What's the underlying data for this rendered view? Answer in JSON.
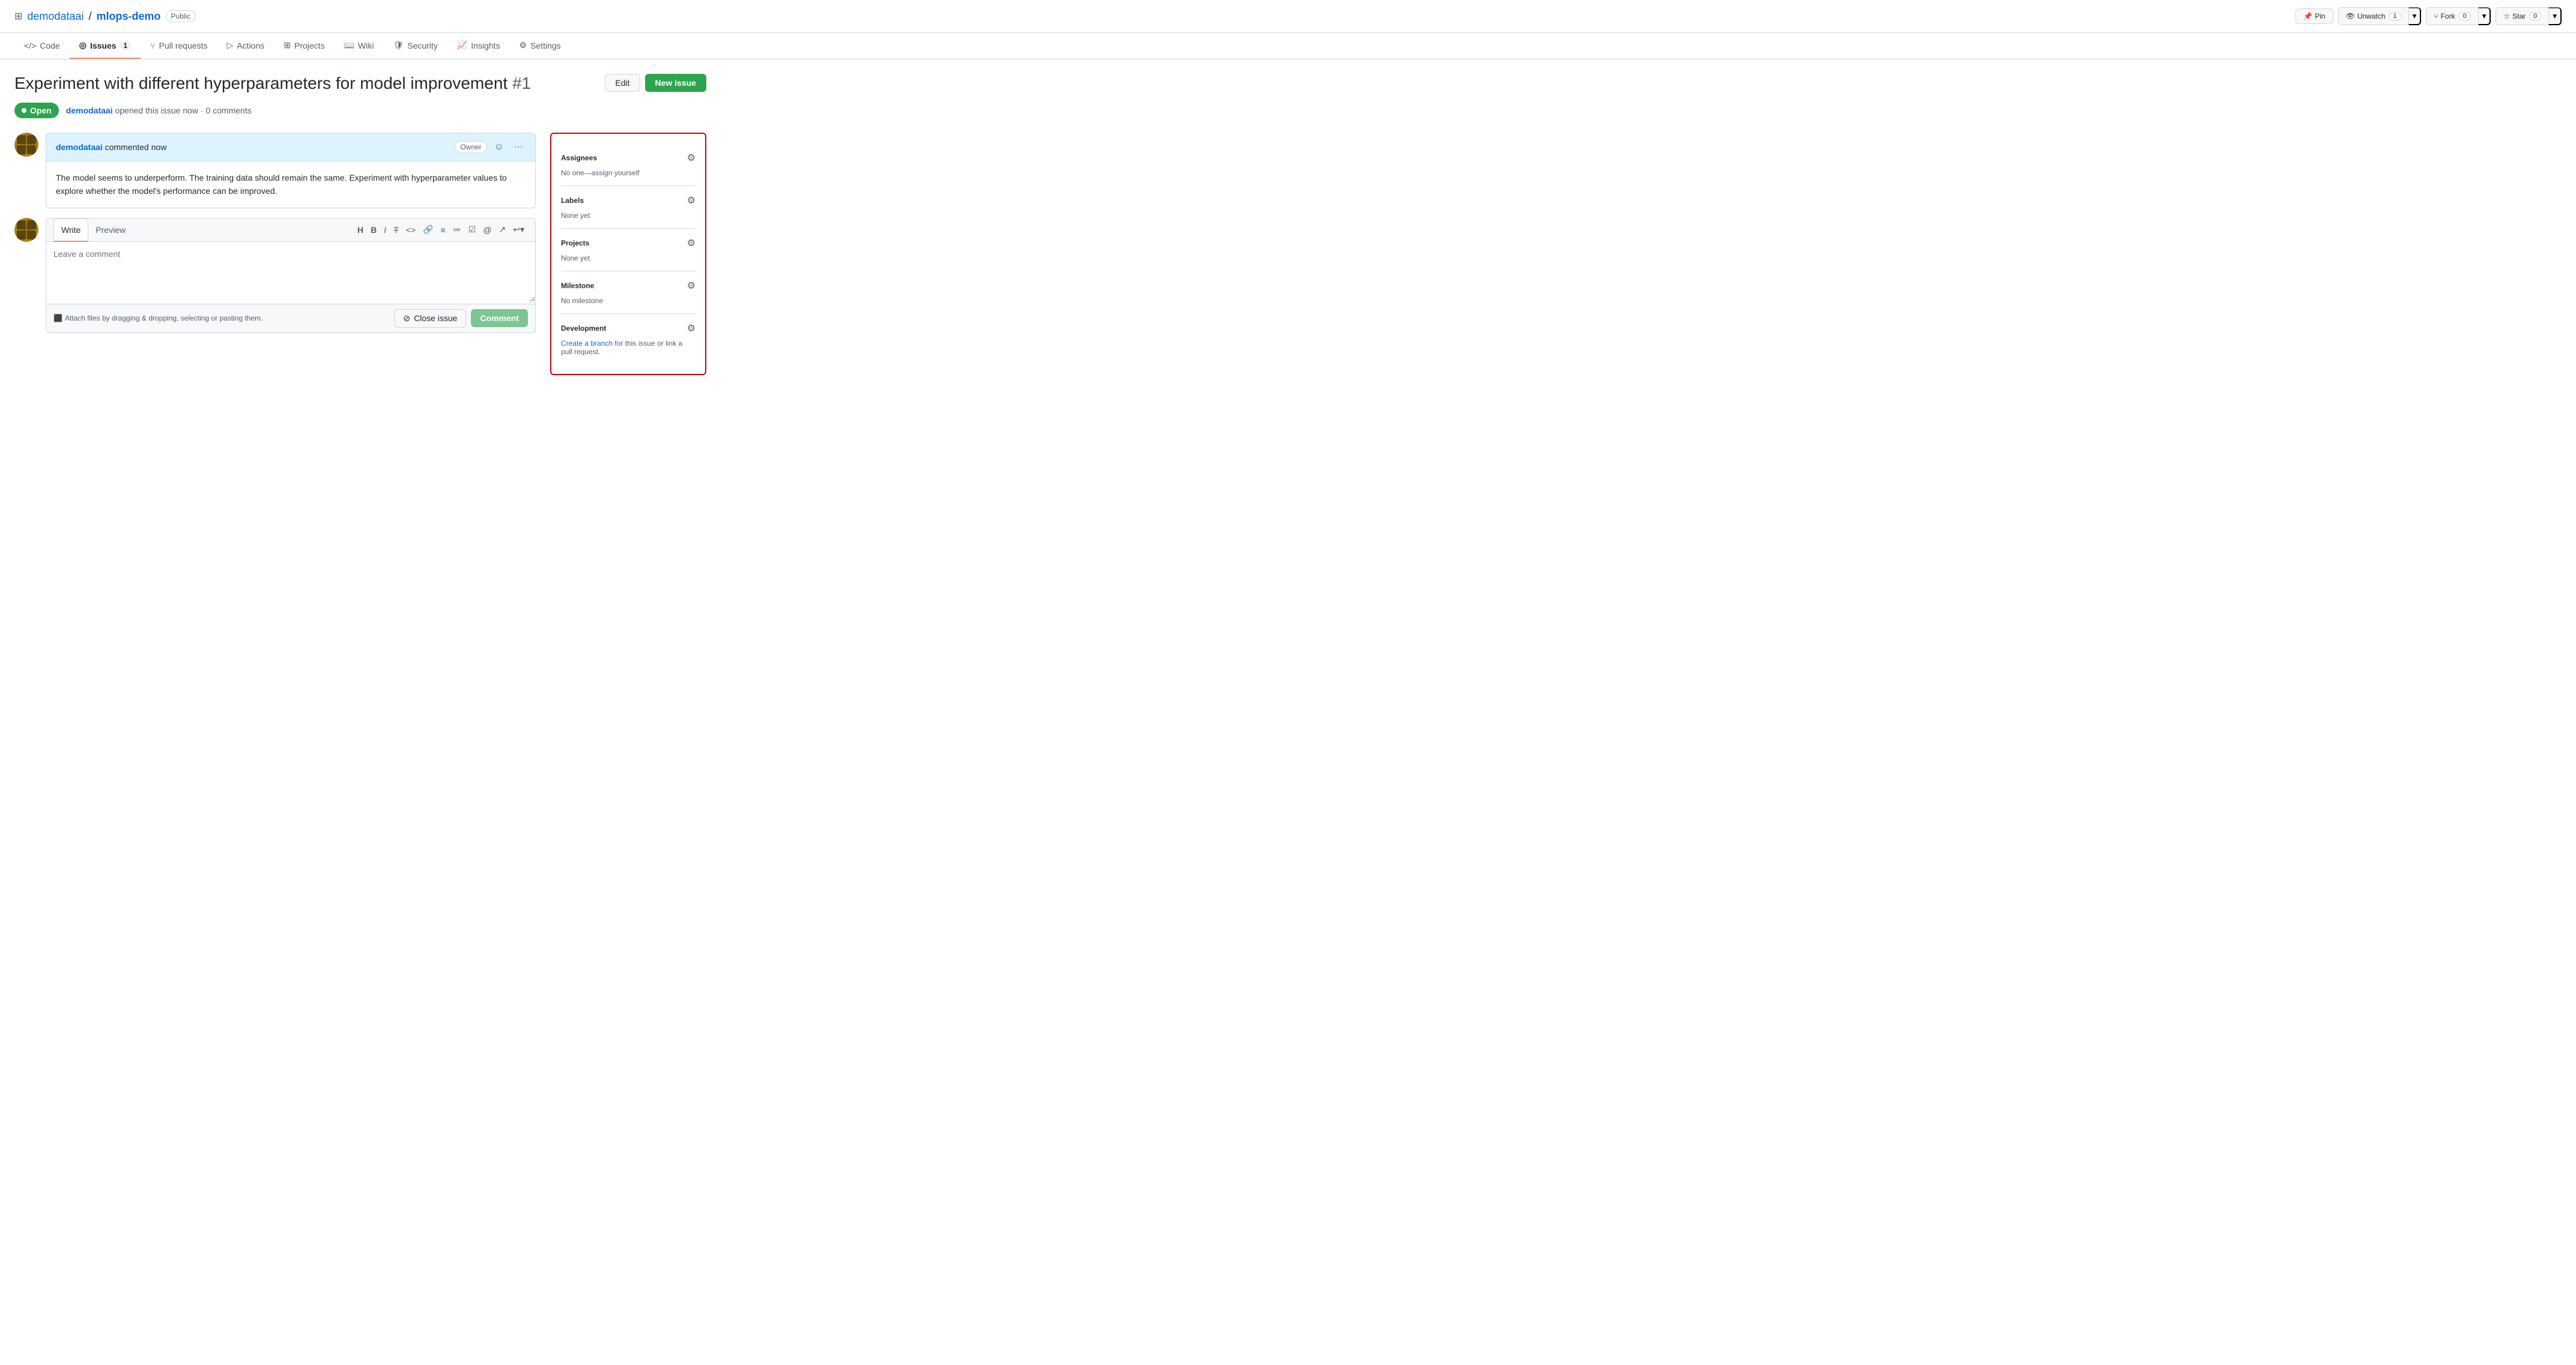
{
  "repo": {
    "owner": "demodataai",
    "name": "mlops-demo",
    "visibility": "Public",
    "icon": "⊞"
  },
  "top_actions": {
    "pin_label": "Pin",
    "unwatch_label": "Unwatch",
    "unwatch_count": "1",
    "fork_label": "Fork",
    "fork_count": "0",
    "star_label": "Star",
    "star_count": "0"
  },
  "nav": {
    "tabs": [
      {
        "id": "code",
        "label": "Code",
        "icon": "<>",
        "active": false
      },
      {
        "id": "issues",
        "label": "Issues",
        "icon": "◎",
        "count": "1",
        "active": true
      },
      {
        "id": "pull-requests",
        "label": "Pull requests",
        "icon": "⑂",
        "active": false
      },
      {
        "id": "actions",
        "label": "Actions",
        "icon": "▷",
        "active": false
      },
      {
        "id": "projects",
        "label": "Projects",
        "icon": "⊞",
        "active": false
      },
      {
        "id": "wiki",
        "label": "Wiki",
        "icon": "📖",
        "active": false
      },
      {
        "id": "security",
        "label": "Security",
        "icon": "🛡",
        "active": false
      },
      {
        "id": "insights",
        "label": "Insights",
        "icon": "📈",
        "active": false
      },
      {
        "id": "settings",
        "label": "Settings",
        "icon": "⚙",
        "active": false
      }
    ]
  },
  "issue": {
    "title": "Experiment with different hyperparameters for model improvement",
    "number": "#1",
    "status": "Open",
    "author": "demodataai",
    "time": "now",
    "comments_count": "0",
    "edit_label": "Edit",
    "new_issue_label": "New issue",
    "meta_text": "opened this issue now · 0 comments"
  },
  "comment": {
    "author": "demodataai",
    "action": "commented",
    "time": "now",
    "owner_badge": "Owner",
    "body": "The model seems to underperform. The training data should remain the same. Experiment with hyperparameter values to explore whether the model's performance can be improved."
  },
  "reply": {
    "write_tab": "Write",
    "preview_tab": "Preview",
    "placeholder": "Leave a comment",
    "footer_text": "Attach files by dragging & dropping, selecting or pasting them.",
    "close_issue_label": "Close issue",
    "comment_label": "Comment"
  },
  "sidebar": {
    "assignees": {
      "title": "Assignees",
      "value": "No one—assign yourself"
    },
    "labels": {
      "title": "Labels",
      "value": "None yet"
    },
    "projects": {
      "title": "Projects",
      "value": "None yet"
    },
    "milestone": {
      "title": "Milestone",
      "value": "No milestone"
    },
    "development": {
      "title": "Development",
      "link_text": "Create a branch",
      "value": " for this issue or link a pull request."
    }
  }
}
